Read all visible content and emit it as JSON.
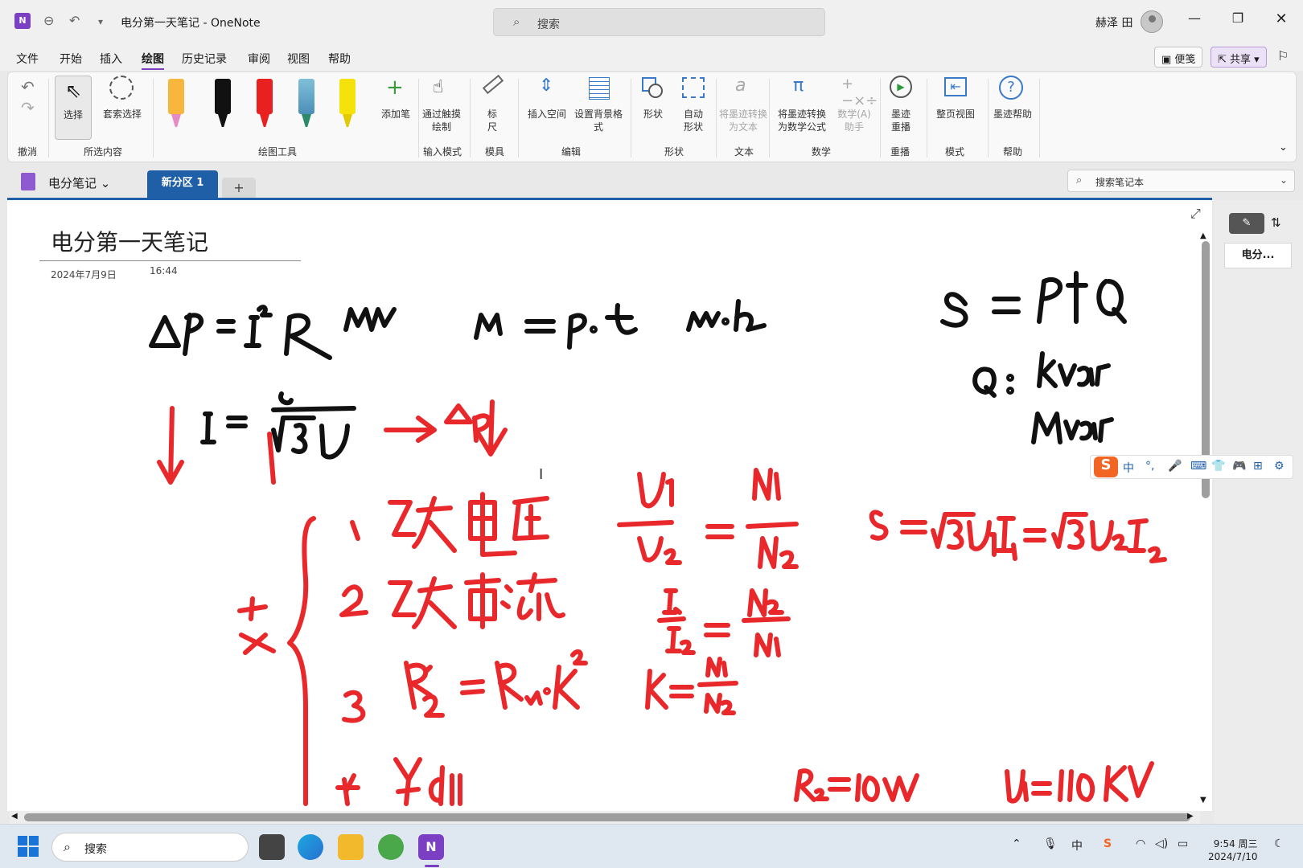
{
  "window": {
    "title": "电分第一天笔记",
    "separator": "-",
    "app_name": "OneNote",
    "search_placeholder": "搜索",
    "user_name": "赫泽 田"
  },
  "menu": [
    "文件",
    "开始",
    "插入",
    "绘图",
    "历史记录",
    "审阅",
    "视图",
    "帮助"
  ],
  "menu_active": "绘图",
  "top_right": {
    "sticky_notes": "便笺",
    "share": "共享"
  },
  "ribbon": {
    "undo_group": "撤消",
    "select_label": "选择",
    "lasso_label": "套索选择",
    "selection_group": "所选内容",
    "add_pen_label": "添加笔",
    "draw_tools_group": "绘图工具",
    "touch_draw_label": "通过触摸绘制",
    "input_mode_group": "输入模式",
    "ruler_label": "标尺",
    "stencil_group": "模具",
    "insert_space_label": "插入空间",
    "bg_format_label": "设置背景格式",
    "edit_group": "编辑",
    "shapes_label": "形状",
    "auto_shape_label": "自动形状",
    "shape_group": "形状",
    "ink_to_text_label": "将墨迹转换为文本",
    "text_group": "文本",
    "ink_to_math_label": "将墨迹转换为数学公式",
    "math_assist_label": "数学(A)助手",
    "math_group": "数学",
    "ink_replay_label": "墨迹重播",
    "replay_group": "重播",
    "full_page_label": "整页视图",
    "mode_group": "模式",
    "ink_help_label": "墨迹帮助",
    "help_group": "帮助"
  },
  "pens": [
    {
      "name": "highlighter-pink",
      "color": "#f6b73c",
      "tip": "#e58cc4"
    },
    {
      "name": "pen-black",
      "color": "#111111",
      "tip": "#111111"
    },
    {
      "name": "pen-red",
      "color": "#e82020",
      "tip": "#e82020"
    },
    {
      "name": "pen-galaxy",
      "color": "#4b8fb8",
      "tip": "#2b8a6b"
    },
    {
      "name": "highlighter-yellow",
      "color": "#f4e20a",
      "tip": "#f4e20a"
    }
  ],
  "notebook": {
    "name": "电分笔记",
    "section_tab": "新分区 1",
    "add_tab": "+",
    "search_placeholder": "搜索笔记本"
  },
  "page": {
    "title": "电分第一天笔记",
    "date": "2024年7月9日",
    "time": "16:44"
  },
  "sidebar": {
    "page_item": "电分..."
  },
  "ime_bar": {
    "items": [
      "中",
      "°,",
      "🎤",
      "⌨",
      "👕",
      "🎮",
      "⊞",
      "⚙"
    ]
  },
  "taskbar": {
    "search_placeholder": "搜索",
    "time": "9:54 周三",
    "date": "2024/7/10",
    "lang": "中"
  },
  "colors": {
    "accent": "#7b3fc4",
    "tab_blue": "#1f5fa8",
    "ink_red": "#e8282b",
    "ink_black": "#111111"
  }
}
